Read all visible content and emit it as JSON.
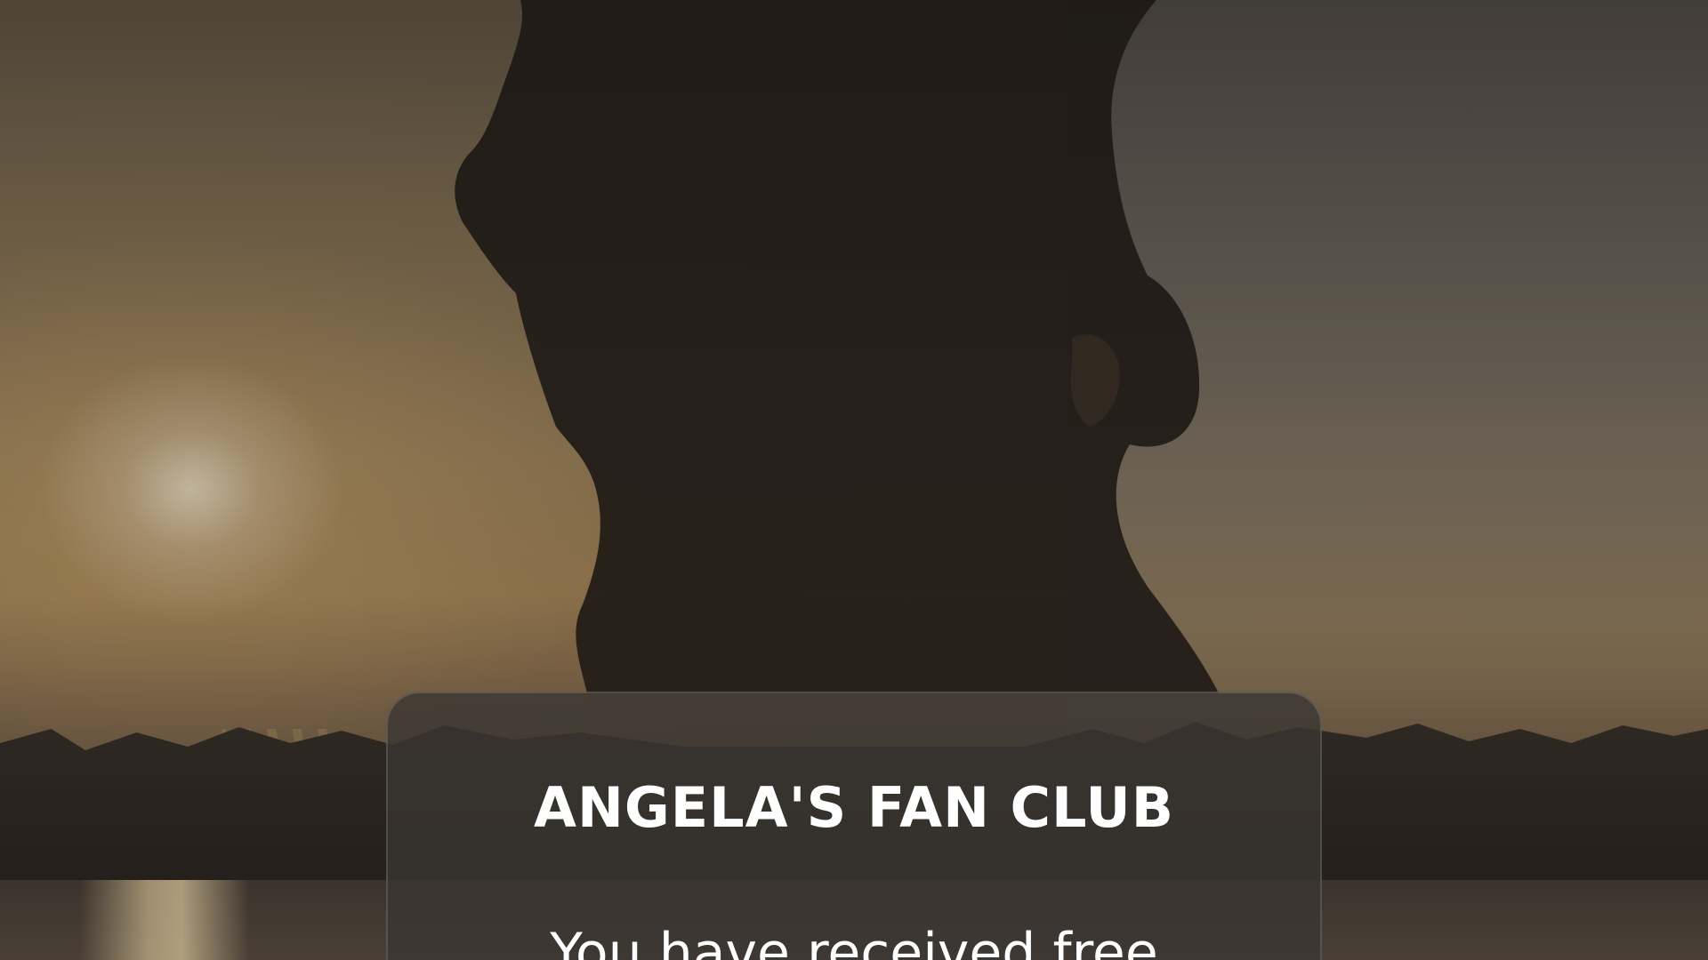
{
  "card": {
    "title": "ANGELA'S FAN CLUB",
    "message": "You have received free"
  },
  "background": {
    "scene": "silhouette-sunset-photo-icon"
  },
  "colors": {
    "card_background": "#3a3632",
    "text": "#ffffff"
  }
}
